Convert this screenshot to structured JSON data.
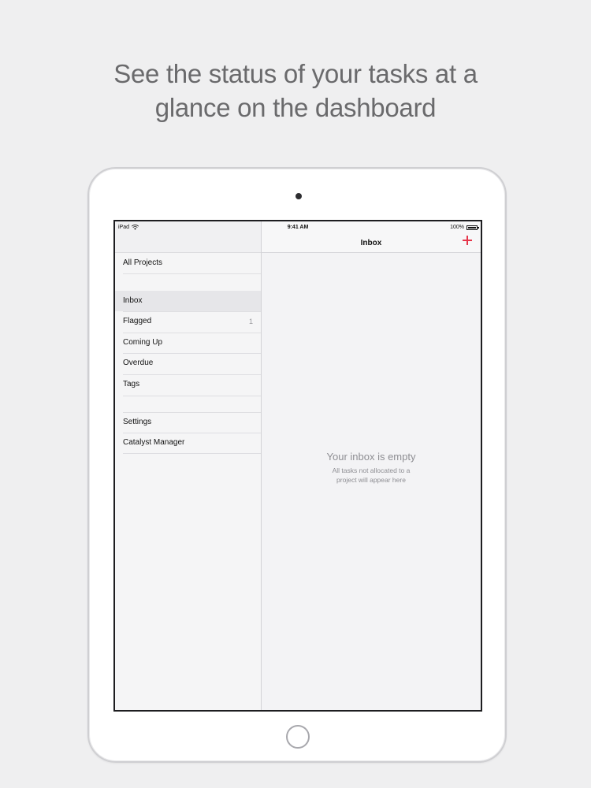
{
  "headline": {
    "line1": "See the status of your tasks at a",
    "line2": "glance on the dashboard"
  },
  "statusbar": {
    "carrier": "iPad",
    "time": "9:41 AM",
    "battery": "100%",
    "icons": [
      "wifi-icon",
      "battery-icon"
    ]
  },
  "sidebar": {
    "all_projects": "All Projects",
    "items": [
      {
        "label": "Inbox",
        "selected": true
      },
      {
        "label": "Flagged",
        "count": "1"
      },
      {
        "label": "Coming Up"
      },
      {
        "label": "Overdue"
      },
      {
        "label": "Tags"
      }
    ],
    "settings_items": [
      {
        "label": "Settings"
      },
      {
        "label": "Catalyst Manager"
      }
    ]
  },
  "detail": {
    "title": "Inbox",
    "add_icon": "plus-icon",
    "empty_title": "Your inbox is empty",
    "empty_subtitle_line1": "All tasks not allocated to a",
    "empty_subtitle_line2": "project will appear here"
  },
  "colors": {
    "background": "#efeff0",
    "accent": "#e6364b",
    "text_muted": "#8e8e93"
  }
}
